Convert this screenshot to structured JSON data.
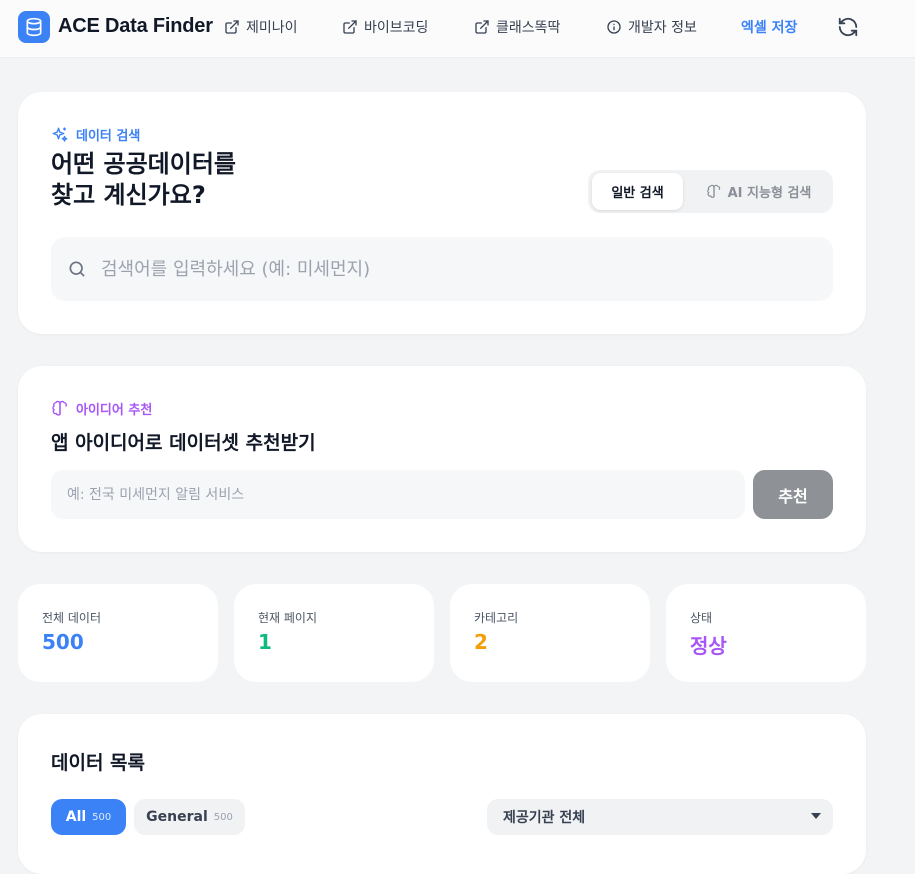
{
  "header": {
    "brand": "ACE Data Finder",
    "links": [
      {
        "label": "제미나이",
        "icon": "external-link-icon"
      },
      {
        "label": "바이브코딩",
        "icon": "external-link-icon"
      },
      {
        "label": "클래스똑딱",
        "icon": "external-link-icon"
      },
      {
        "label": "개발자 정보",
        "icon": "info-icon"
      }
    ],
    "save_label": "엑셀 저장",
    "accent": "#3b82f6"
  },
  "search": {
    "tag": "데이터 검색",
    "heading_line1": "어떤 공공데이터를",
    "heading_line2": "찾고 계신가요?",
    "mode_general": "일반 검색",
    "mode_ai": "AI 지능형 검색",
    "placeholder": "검색어를 입력하세요 (예: 미세먼지)"
  },
  "idea": {
    "tag": "아이디어 추천",
    "heading": "앱 아이디어로 데이터셋 추천받기",
    "placeholder": "예: 전국 미세먼지 알림 서비스",
    "button": "추천",
    "accent": "#a855f7"
  },
  "stats": [
    {
      "label": "전체 데이터",
      "value": "500",
      "color": "#3b82f6"
    },
    {
      "label": "현재 페이지",
      "value": "1",
      "color": "#10b981"
    },
    {
      "label": "카테고리",
      "value": "2",
      "color": "#f59e0b"
    },
    {
      "label": "상태",
      "value": "정상",
      "color": "#a855f7"
    }
  ],
  "list": {
    "title": "데이터 목록",
    "chips": [
      {
        "label": "All",
        "count": "500"
      },
      {
        "label": "General",
        "count": "500"
      }
    ],
    "org_select": "제공기관 전체"
  }
}
